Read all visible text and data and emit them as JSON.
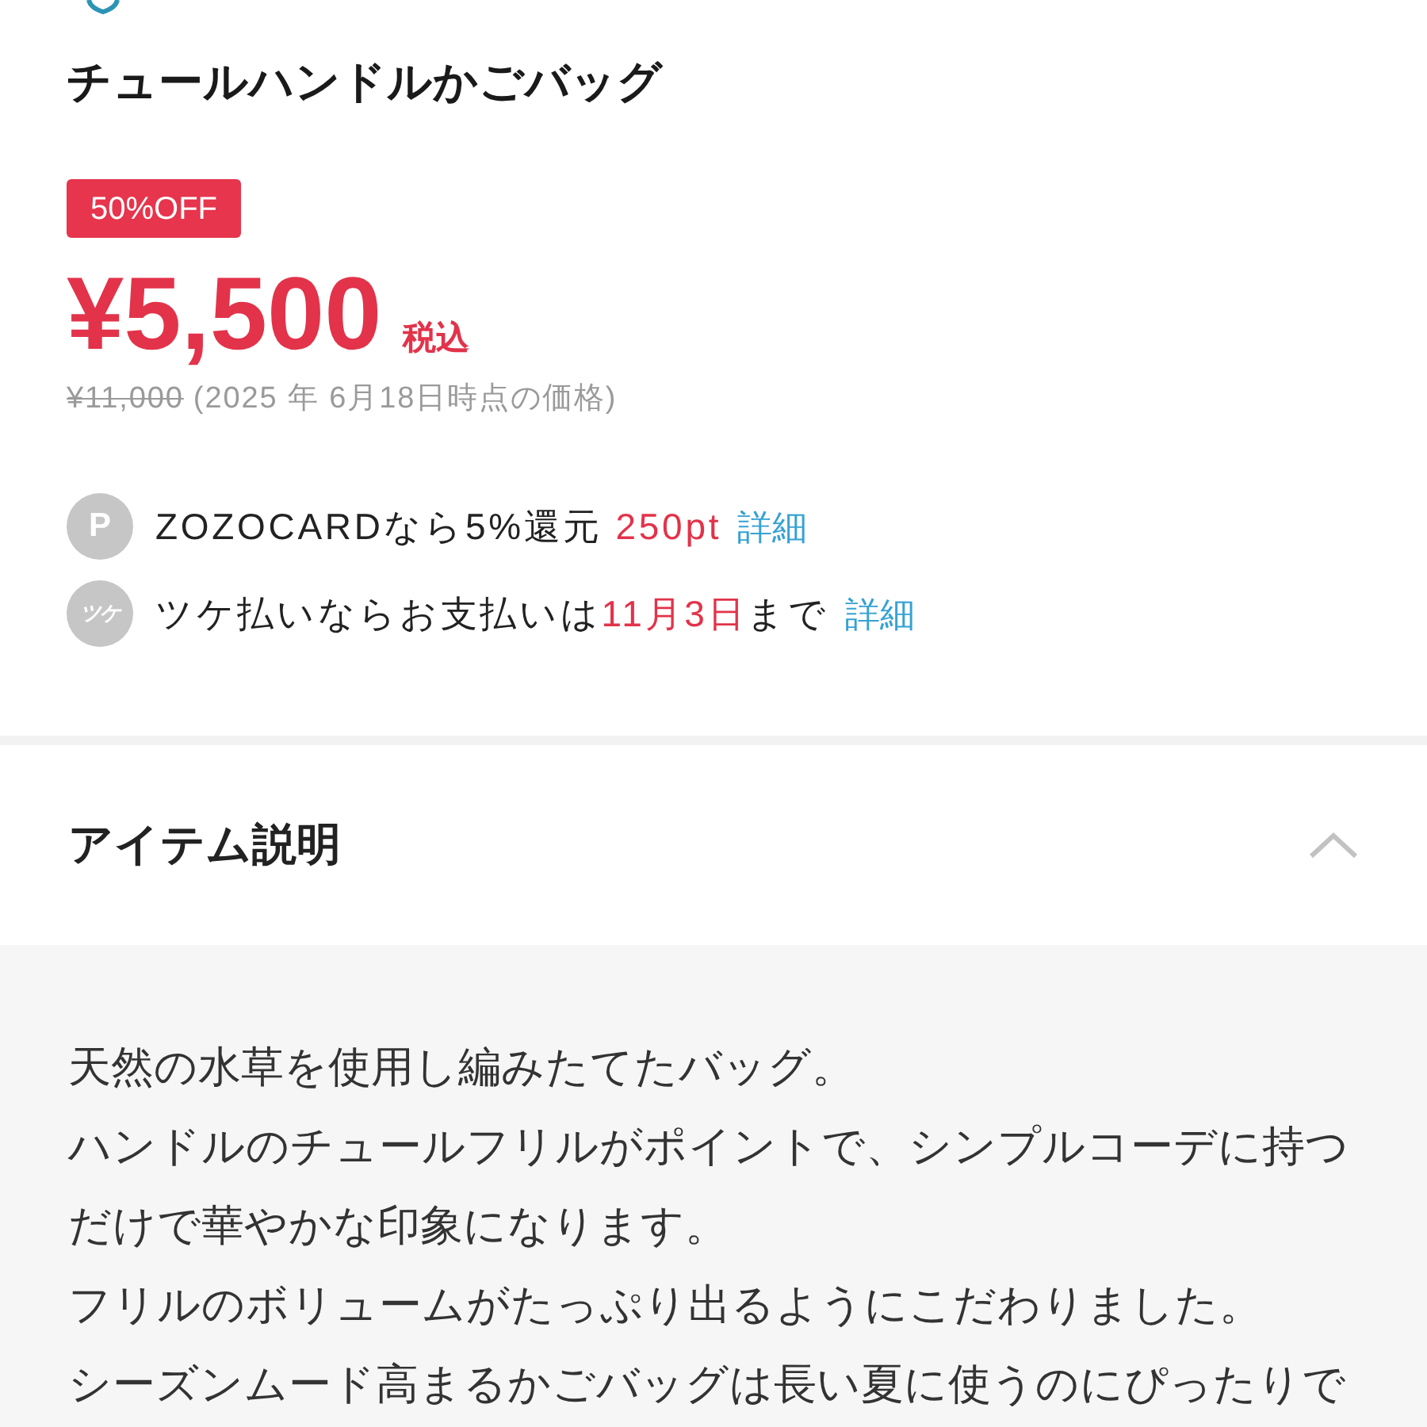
{
  "product": {
    "name": "チュールハンドルかごバッグ",
    "discount_badge": "50%OFF",
    "price": "¥5,500",
    "tax_note": "税込",
    "original_price": "¥11,000",
    "price_date_note": "(2025 年 6月18日時点の価格)"
  },
  "perks": [
    {
      "kind": "points",
      "badge": "P",
      "segments": [
        {
          "text": "ZOZOCARDなら5%還元 ",
          "highlight": false
        },
        {
          "text": "250pt",
          "highlight": true
        }
      ],
      "link": "詳細"
    },
    {
      "kind": "pay_later",
      "badge": "ツケ",
      "segments": [
        {
          "text": "ツケ払いならお支払いは",
          "highlight": false
        },
        {
          "text": "11月3日",
          "highlight": true
        },
        {
          "text": "まで",
          "highlight": false
        }
      ],
      "link": "詳細"
    }
  ],
  "description_section": {
    "title": "アイテム説明",
    "expanded": true,
    "paragraphs": [
      "天然の水草を使用し編みたてたバッグ。",
      "ハンドルのチュールフリルがポイントで、シンプルコーデに持つだけで華やかな印象になります。",
      "フリルのボリュームがたっぷり出るようにこだわりました。",
      "シーズンムード高まるかごバッグは長い夏に使うのにぴったりで"
    ]
  }
}
